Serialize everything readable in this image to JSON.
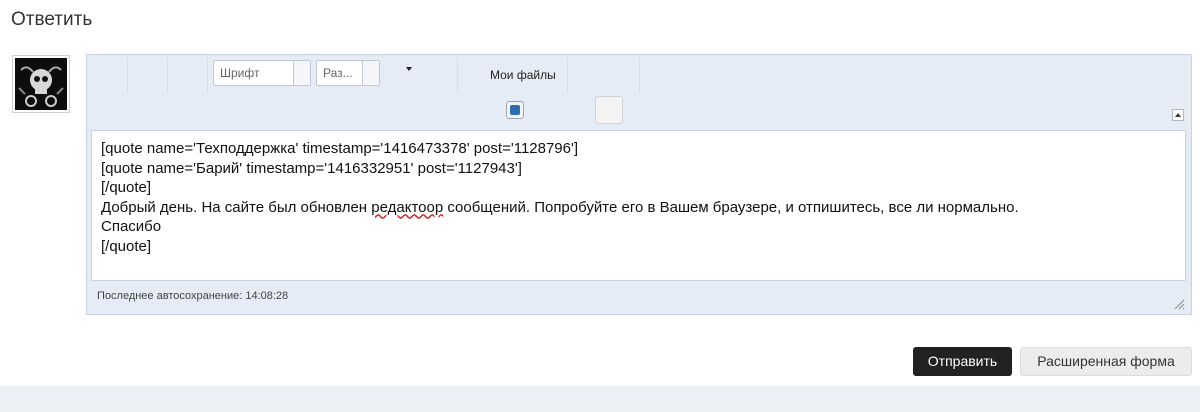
{
  "page": {
    "title": "Ответить"
  },
  "editor": {
    "font_select": {
      "value": "Шрифт"
    },
    "size_select": {
      "value": "Раз..."
    },
    "my_files_label": "Мои файлы",
    "content": {
      "line1": "[quote name='Техподдержка' timestamp='1416473378' post='1128796']",
      "line2": "[quote name='Барий' timestamp='1416332951' post='1127943']",
      "line3": "[/quote]",
      "line4_before": "Добрый день. На сайте был обновлен ",
      "line4_misspelled": "редактоор",
      "line4_after": " сообщений. Попробуйте его в Вашем браузере, и отпишитесь, все ли нормально.",
      "line5": "Спасибо",
      "line6": "[/quote]"
    },
    "autosave_text": "Последнее автосохранение: 14:08:28"
  },
  "actions": {
    "submit_label": "Отправить",
    "extended_form_label": "Расширенная форма"
  },
  "colors": {
    "editor_bg": "#e5ecf5",
    "submit_bg": "#222222",
    "extended_bg": "#ececec"
  },
  "icons": [
    "avatar-skull-image",
    "chevron-down-icon",
    "twitter-icon",
    "collapse-toggle-icon",
    "resize-grip-icon"
  ]
}
